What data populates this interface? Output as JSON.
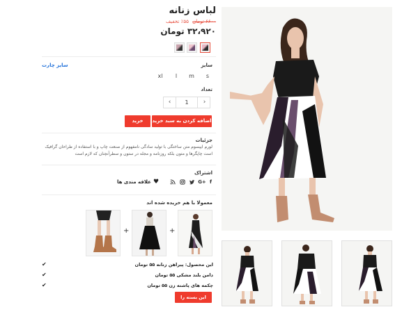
{
  "product": {
    "title": "لباس زنانه",
    "old_price": "۶۶۰۰ تومان",
    "discount": "۵۵٪ تخفیف",
    "price": "۳۲،۹۲۰ تومان"
  },
  "size": {
    "label": "سایز",
    "chart_link": "سایز چارت",
    "options": [
      "s",
      "m",
      "l",
      "xl"
    ]
  },
  "quantity": {
    "label": "تعداد",
    "value": "1",
    "plus": "›",
    "minus": "‹"
  },
  "buttons": {
    "add_to_cart": "اضافه کردن به سبد خرید",
    "buy": "خرید"
  },
  "details": {
    "label": "جزئیات",
    "text": "لورم ایپسوم متن ساختگی با تولید سادگی نامفهوم از صنعت چاپ و با استفاده از طراحان گرافیک است چاپگرها و متون بلکه روزنامه و مجله در ستون و سطرآنچنان که لازم است"
  },
  "share": {
    "label": "اشتراک",
    "wishlist": "علاقه مندی ها"
  },
  "bundle": {
    "title": "معمولا با هم خریده شده اند",
    "items": [
      {
        "name": "این محصول: پیراهن زنانه",
        "price": "۵۵ تومان"
      },
      {
        "name": "دامن بلند مشکی",
        "price": "۵۵ تومان"
      },
      {
        "name": "چکمه های پاشنه زن",
        "price": "۵۵ تومان"
      }
    ],
    "button": "این بسته را بخرید"
  },
  "colors": {
    "accent": "#ef3b2d",
    "link": "#1e6fd9"
  }
}
